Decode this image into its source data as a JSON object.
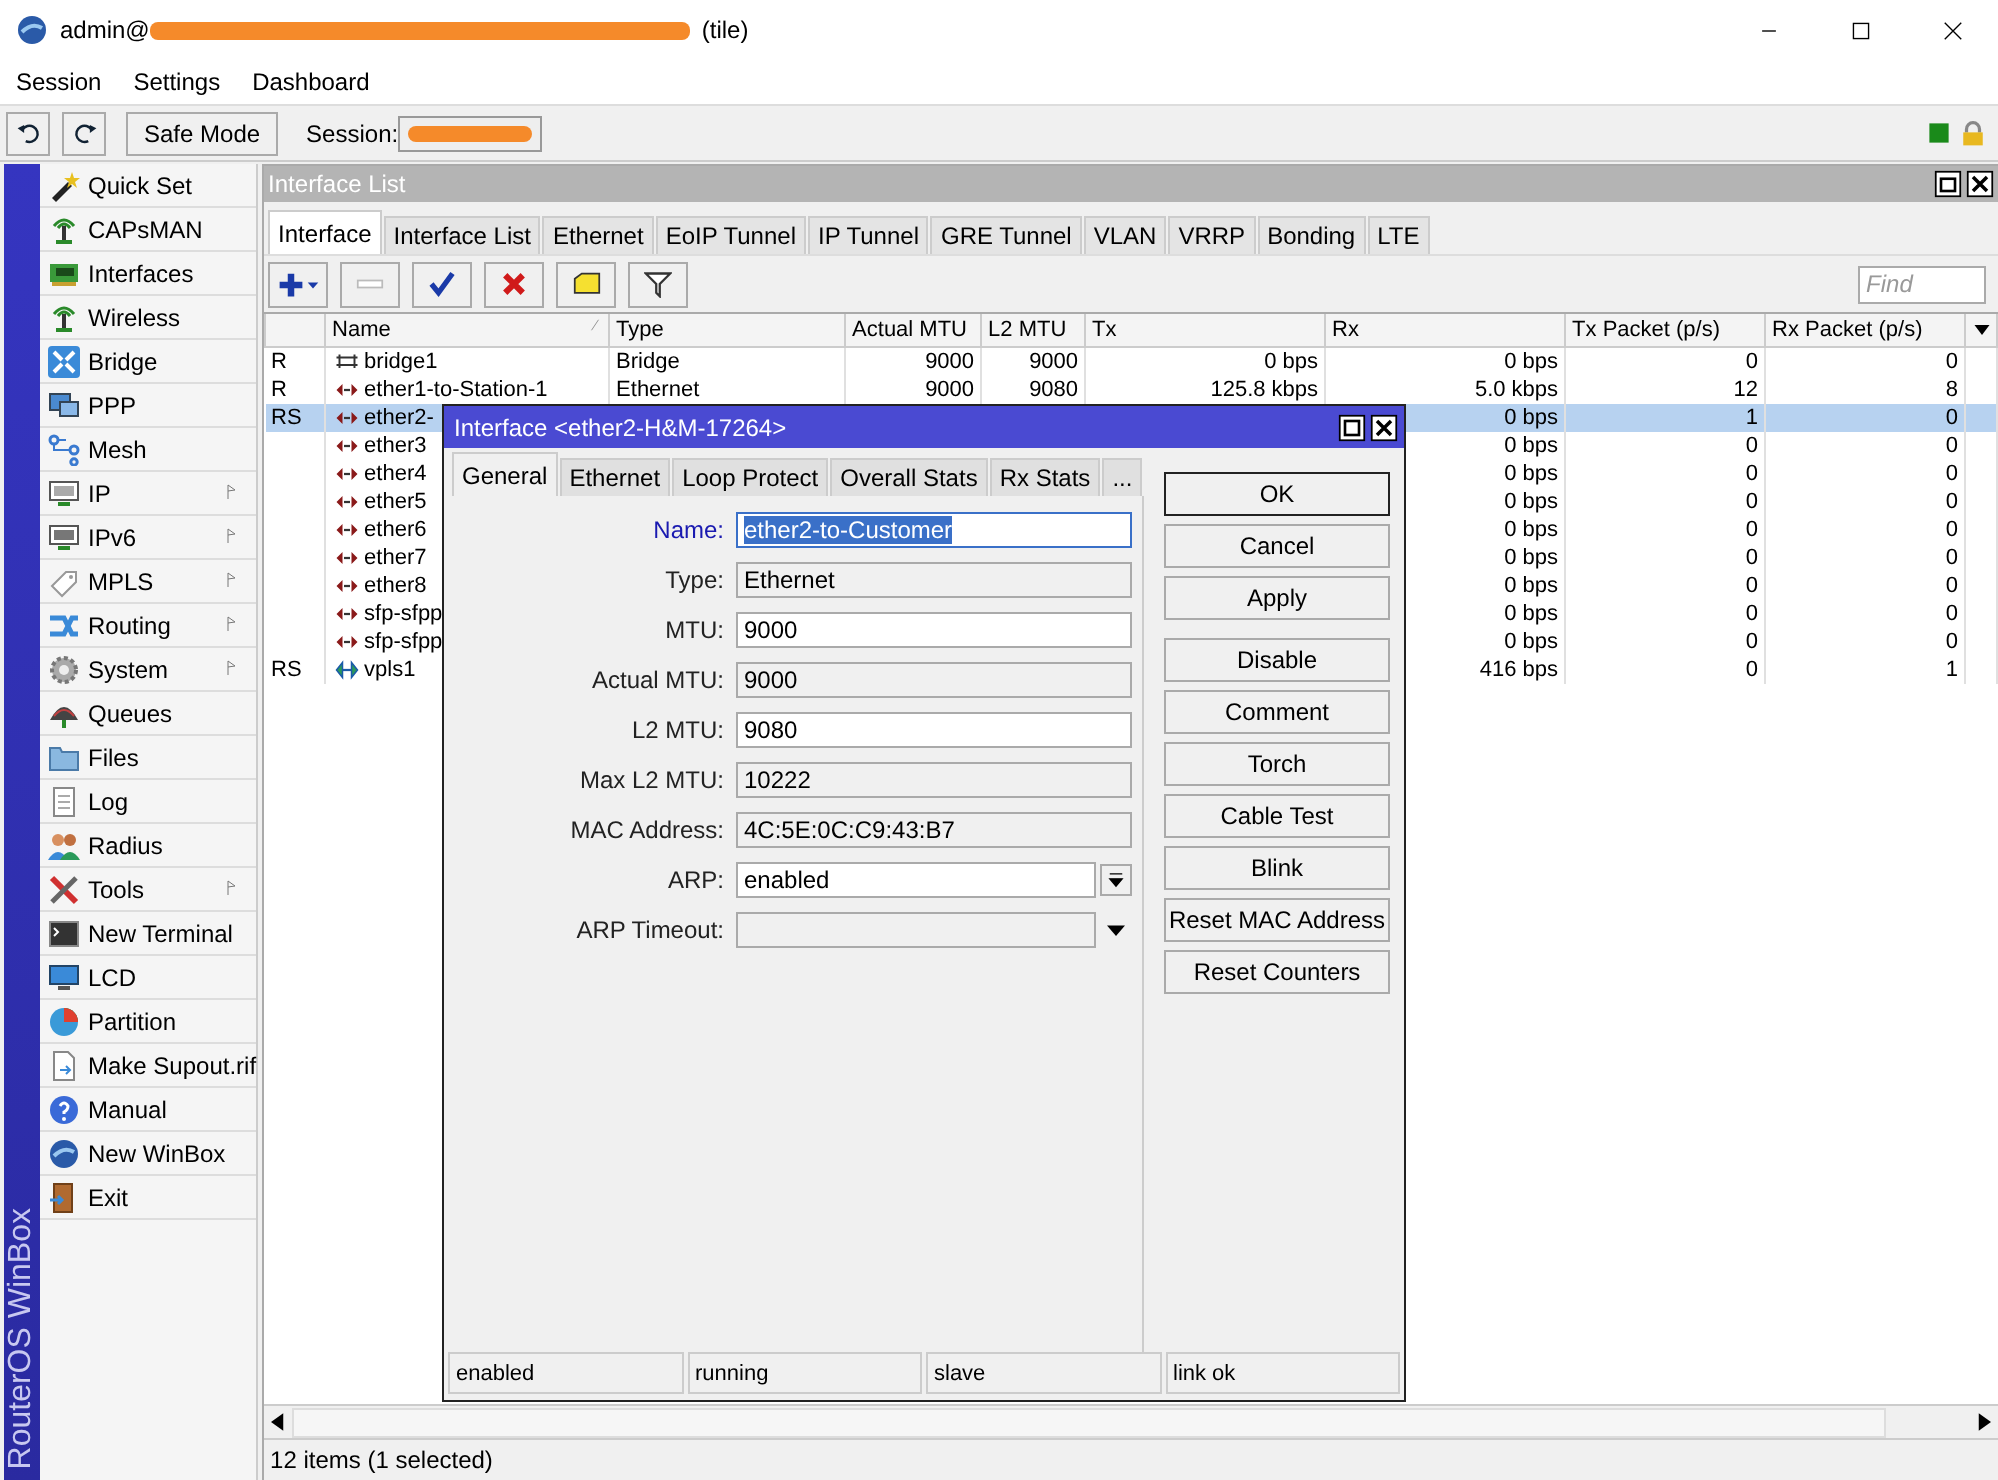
{
  "window": {
    "title_prefix": "admin@",
    "title_suffix": "(tile)"
  },
  "menu": [
    "Session",
    "Settings",
    "Dashboard"
  ],
  "toolbar": {
    "safe_mode": "Safe Mode",
    "session_label": "Session:"
  },
  "sidebar": {
    "brand": "RouterOS WinBox",
    "items": [
      {
        "label": "Quick Set",
        "submenu": false
      },
      {
        "label": "CAPsMAN",
        "submenu": false
      },
      {
        "label": "Interfaces",
        "submenu": false
      },
      {
        "label": "Wireless",
        "submenu": false
      },
      {
        "label": "Bridge",
        "submenu": false
      },
      {
        "label": "PPP",
        "submenu": false
      },
      {
        "label": "Mesh",
        "submenu": false
      },
      {
        "label": "IP",
        "submenu": true
      },
      {
        "label": "IPv6",
        "submenu": true
      },
      {
        "label": "MPLS",
        "submenu": true
      },
      {
        "label": "Routing",
        "submenu": true
      },
      {
        "label": "System",
        "submenu": true
      },
      {
        "label": "Queues",
        "submenu": false
      },
      {
        "label": "Files",
        "submenu": false
      },
      {
        "label": "Log",
        "submenu": false
      },
      {
        "label": "Radius",
        "submenu": false
      },
      {
        "label": "Tools",
        "submenu": true
      },
      {
        "label": "New Terminal",
        "submenu": false
      },
      {
        "label": "LCD",
        "submenu": false
      },
      {
        "label": "Partition",
        "submenu": false
      },
      {
        "label": "Make Supout.rif",
        "submenu": false
      },
      {
        "label": "Manual",
        "submenu": false
      },
      {
        "label": "New WinBox",
        "submenu": false
      },
      {
        "label": "Exit",
        "submenu": false
      }
    ]
  },
  "interface_list": {
    "title": "Interface List",
    "tabs": [
      {
        "label": "Interface",
        "selected": true
      },
      {
        "label": "Interface List",
        "selected": false
      },
      {
        "label": "Ethernet",
        "selected": false
      },
      {
        "label": "EoIP Tunnel",
        "selected": false
      },
      {
        "label": "IP Tunnel",
        "selected": false
      },
      {
        "label": "GRE Tunnel",
        "selected": false
      },
      {
        "label": "VLAN",
        "selected": false
      },
      {
        "label": "VRRP",
        "selected": false
      },
      {
        "label": "Bonding",
        "selected": false
      },
      {
        "label": "LTE",
        "selected": false
      }
    ],
    "find": {
      "placeholder": "Find"
    },
    "table": {
      "columns": [
        "",
        "Name",
        "Type",
        "Actual MTU",
        "L2 MTU",
        "Tx",
        "Rx",
        "Tx Packet (p/s)",
        "Rx Packet (p/s)"
      ],
      "rows": [
        {
          "kind": "bridge",
          "flag": "R",
          "name": "bridge1",
          "type": "Bridge",
          "actual_mtu": "9000",
          "l2_mtu": "9000",
          "tx": "0 bps",
          "rx": "0 bps",
          "tx_packet": "0",
          "rx_packet": "0",
          "selected": false
        },
        {
          "kind": "ether",
          "flag": "R",
          "name": "ether1-to-Station-1",
          "type": "Ethernet",
          "actual_mtu": "9000",
          "l2_mtu": "9080",
          "tx": "125.8 kbps",
          "rx": "5.0 kbps",
          "tx_packet": "12",
          "rx_packet": "8",
          "selected": false
        },
        {
          "kind": "ether",
          "flag": "RS",
          "name": "ether2-",
          "rx": "0 bps",
          "tx_packet": "1",
          "rx_packet": "0",
          "selected": true
        },
        {
          "kind": "ether",
          "name": "ether3",
          "rx": "0 bps",
          "tx_packet": "0",
          "rx_packet": "0",
          "selected": false
        },
        {
          "kind": "ether",
          "name": "ether4",
          "rx": "0 bps",
          "tx_packet": "0",
          "rx_packet": "0",
          "selected": false
        },
        {
          "kind": "ether",
          "name": "ether5",
          "rx": "0 bps",
          "tx_packet": "0",
          "rx_packet": "0",
          "selected": false
        },
        {
          "kind": "ether",
          "name": "ether6",
          "rx": "0 bps",
          "tx_packet": "0",
          "rx_packet": "0",
          "selected": false
        },
        {
          "kind": "ether",
          "name": "ether7",
          "rx": "0 bps",
          "tx_packet": "0",
          "rx_packet": "0",
          "selected": false
        },
        {
          "kind": "ether",
          "name": "ether8",
          "rx": "0 bps",
          "tx_packet": "0",
          "rx_packet": "0",
          "selected": false
        },
        {
          "kind": "ether",
          "name": "sfp-sfpp",
          "rx": "0 bps",
          "tx_packet": "0",
          "rx_packet": "0",
          "selected": false
        },
        {
          "kind": "ether",
          "name": "sfp-sfpp",
          "rx": "0 bps",
          "tx_packet": "0",
          "rx_packet": "0",
          "selected": false
        },
        {
          "kind": "vpls",
          "flag": "RS",
          "name": "vpls1",
          "rx": "416 bps",
          "tx_packet": "0",
          "rx_packet": "1",
          "selected": false
        }
      ]
    },
    "status": "12 items (1 selected)"
  },
  "dialog": {
    "title": "Interface <ether2-H&M-17264>",
    "tabs": [
      {
        "label": "General",
        "selected": true
      },
      {
        "label": "Ethernet",
        "selected": false
      },
      {
        "label": "Loop Protect",
        "selected": false
      },
      {
        "label": "Overall Stats",
        "selected": false
      },
      {
        "label": "Rx Stats",
        "selected": false
      },
      {
        "label": "...",
        "selected": false
      }
    ],
    "fields": [
      {
        "kind": "input",
        "label": "Name:",
        "value": "ether2-to-Customer",
        "focused": true
      },
      {
        "kind": "readonly",
        "label": "Type:",
        "value": "Ethernet",
        "focused": false
      },
      {
        "kind": "input",
        "label": "MTU:",
        "value": "9000",
        "focused": false
      },
      {
        "kind": "readonly",
        "label": "Actual MTU:",
        "value": "9000",
        "focused": false
      },
      {
        "kind": "input",
        "label": "L2 MTU:",
        "value": "9080",
        "focused": false
      },
      {
        "kind": "readonly",
        "label": "Max L2 MTU:",
        "value": "10222",
        "focused": false
      },
      {
        "kind": "readonly",
        "label": "MAC Address:",
        "value": "4C:5E:0C:C9:43:B7",
        "focused": false
      },
      {
        "kind": "dropdown",
        "label": "ARP:",
        "value": "enabled",
        "focused": false
      },
      {
        "kind": "combo",
        "label": "ARP Timeout:",
        "focused": false
      }
    ],
    "button_groups": [
      [
        {
          "label": "OK",
          "default": true
        },
        {
          "label": "Cancel",
          "default": false
        },
        {
          "label": "Apply",
          "default": false
        }
      ],
      [
        {
          "label": "Disable",
          "default": false
        },
        {
          "label": "Comment",
          "default": false
        },
        {
          "label": "Torch",
          "default": false
        },
        {
          "label": "Cable Test",
          "default": false
        },
        {
          "label": "Blink",
          "default": false
        },
        {
          "label": "Reset MAC Address",
          "default": false
        },
        {
          "label": "Reset Counters",
          "default": false
        }
      ]
    ],
    "status": [
      "enabled",
      "running",
      "slave",
      "link ok"
    ]
  }
}
